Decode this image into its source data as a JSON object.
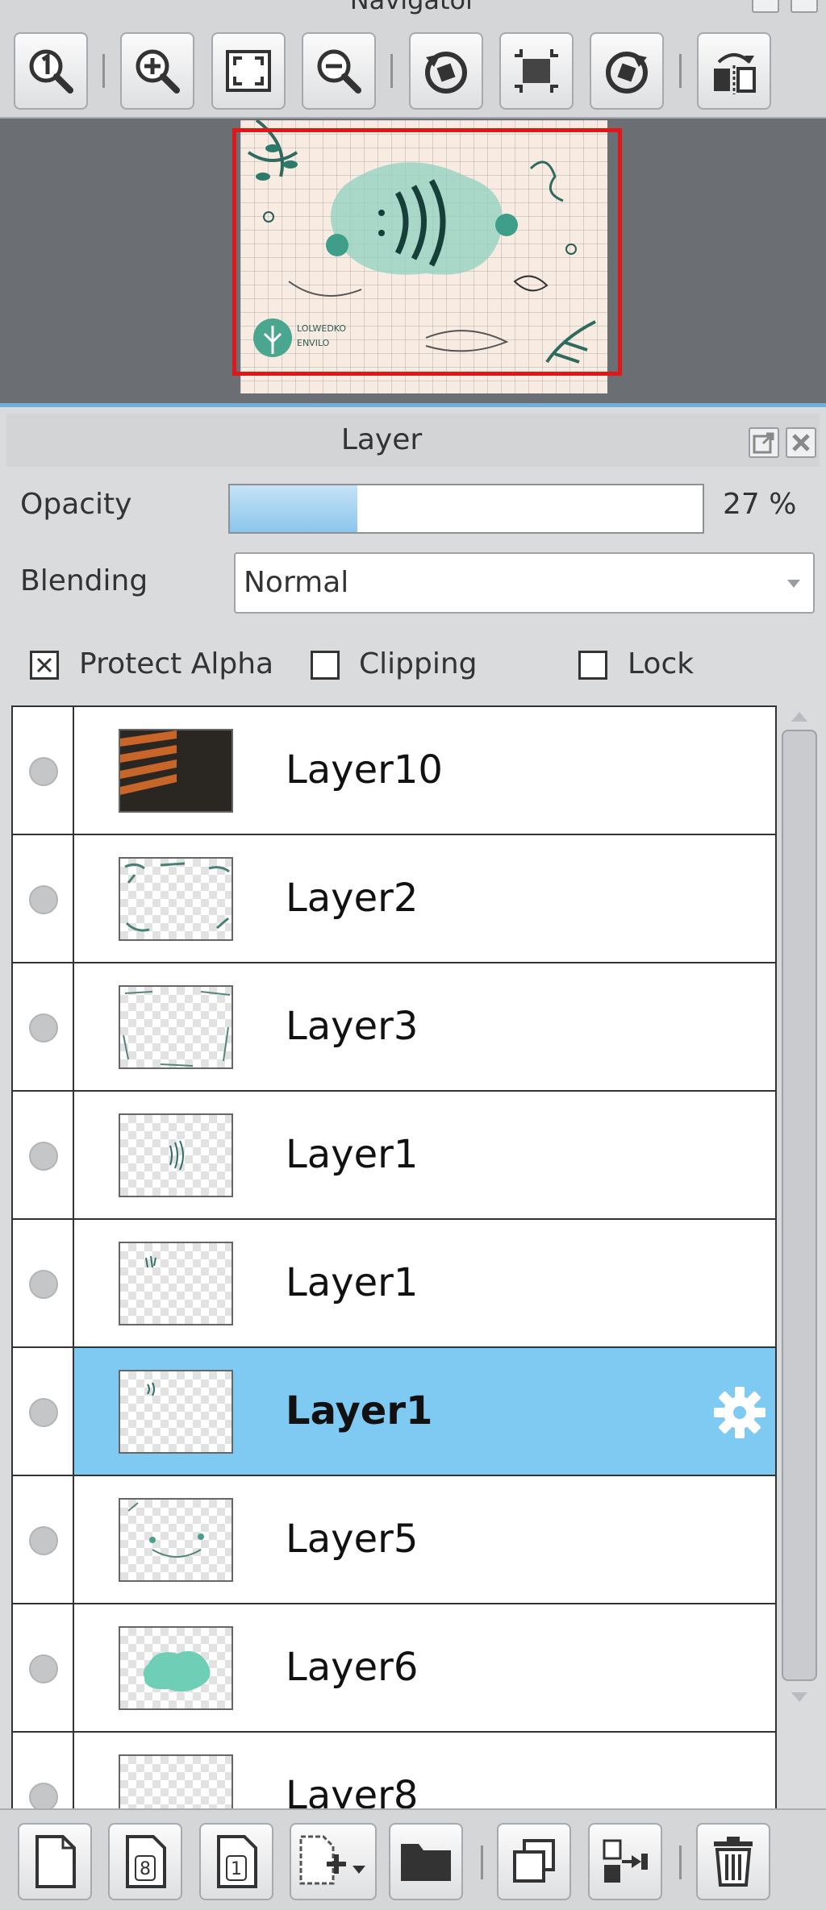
{
  "navigator": {
    "title": "Navigator",
    "toolbar": [
      "actual-size",
      "zoom-in",
      "fit-window",
      "zoom-out",
      "rotate-left",
      "reset-rotation",
      "rotate-right",
      "flip-horizontal"
    ]
  },
  "layer_panel": {
    "title": "Layer",
    "opacity_label": "Opacity",
    "opacity_value": "27 %",
    "opacity_fraction": 0.27,
    "blending_label": "Blending",
    "blending_value": "Normal",
    "protect_alpha": {
      "label": "Protect Alpha",
      "checked": true
    },
    "clipping": {
      "label": "Clipping",
      "checked": false
    },
    "lock": {
      "label": "Lock",
      "checked": false
    },
    "layers": [
      {
        "name": "Layer10",
        "selected": false
      },
      {
        "name": "Layer2",
        "selected": false
      },
      {
        "name": "Layer3",
        "selected": false
      },
      {
        "name": "Layer1",
        "selected": false
      },
      {
        "name": "Layer1",
        "selected": false
      },
      {
        "name": "Layer1",
        "selected": true
      },
      {
        "name": "Layer5",
        "selected": false
      },
      {
        "name": "Layer6",
        "selected": false
      },
      {
        "name": "Layer8",
        "selected": false
      }
    ],
    "bottom_toolbar": [
      "new-layer",
      "new-8bit-layer",
      "new-1bit-layer",
      "add-layer-menu",
      "new-folder",
      "duplicate-layer",
      "merge-down",
      "delete-layer"
    ]
  },
  "colors": {
    "selected_row": "#7fcaf3",
    "accent": "#6db0dc",
    "navigator_frame": "#e0161b"
  }
}
